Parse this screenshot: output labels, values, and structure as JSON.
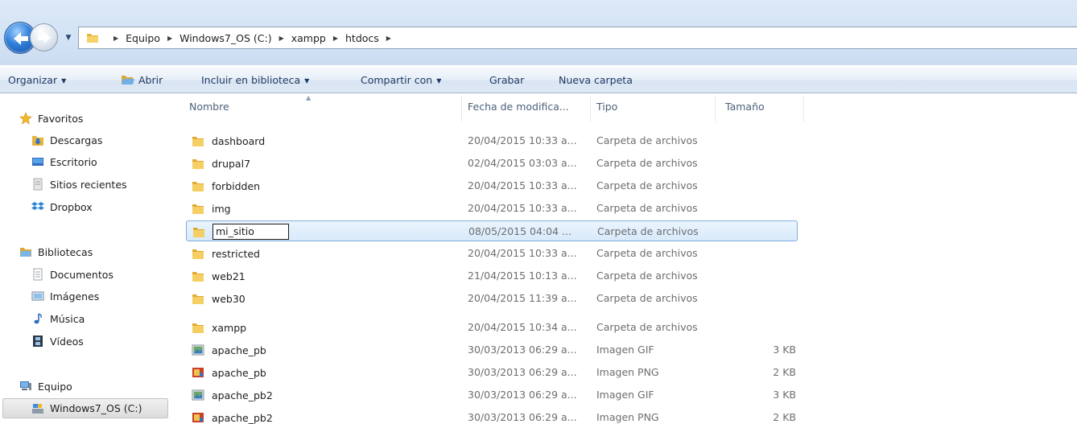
{
  "address_bar": {
    "crumbs": [
      "Equipo",
      "Windows7_OS (C:)",
      "xampp",
      "htdocs"
    ]
  },
  "toolbar": {
    "organize": "Organizar",
    "open": "Abrir",
    "include_library": "Incluir en biblioteca",
    "share_with": "Compartir con",
    "burn": "Grabar",
    "new_folder": "Nueva carpeta"
  },
  "nav": {
    "favorites": "Favoritos",
    "downloads": "Descargas",
    "desktop": "Escritorio",
    "recent": "Sitios recientes",
    "dropbox": "Dropbox",
    "libraries": "Bibliotecas",
    "documents": "Documentos",
    "images": "Imágenes",
    "music": "Música",
    "videos": "Vídeos",
    "computer": "Equipo",
    "drive_c": "Windows7_OS (C:)"
  },
  "columns": {
    "name": "Nombre",
    "date": "Fecha de modifica...",
    "type": "Tipo",
    "size": "Tamaño"
  },
  "files": [
    {
      "name": "dashboard",
      "date": "20/04/2015 10:33 a...",
      "type": "Carpeta de archivos",
      "size": "",
      "icon": "folder-icon"
    },
    {
      "name": "drupal7",
      "date": "02/04/2015 03:03 a...",
      "type": "Carpeta de archivos",
      "size": "",
      "icon": "folder-icon"
    },
    {
      "name": "forbidden",
      "date": "20/04/2015 10:33 a...",
      "type": "Carpeta de archivos",
      "size": "",
      "icon": "folder-icon"
    },
    {
      "name": "img",
      "date": "20/04/2015 10:33 a...",
      "type": "Carpeta de archivos",
      "size": "",
      "icon": "folder-icon"
    },
    {
      "name": "mi_sitio",
      "date": "08/05/2015 04:04 ...",
      "type": "Carpeta de archivos",
      "size": "",
      "icon": "folder-icon"
    },
    {
      "name": "restricted",
      "date": "20/04/2015 10:33 a...",
      "type": "Carpeta de archivos",
      "size": "",
      "icon": "folder-icon"
    },
    {
      "name": "web21",
      "date": "21/04/2015 10:13 a...",
      "type": "Carpeta de archivos",
      "size": "",
      "icon": "folder-icon"
    },
    {
      "name": "web30",
      "date": "20/04/2015 11:39 a...",
      "type": "Carpeta de archivos",
      "size": "",
      "icon": "folder-icon"
    },
    {
      "name": "xampp",
      "date": "20/04/2015 10:34 a...",
      "type": "Carpeta de archivos",
      "size": "",
      "icon": "folder-icon"
    },
    {
      "name": "apache_pb",
      "date": "30/03/2013 06:29 a...",
      "type": "Imagen GIF",
      "size": "3 KB",
      "icon": "gif-file-icon"
    },
    {
      "name": "apache_pb",
      "date": "30/03/2013 06:29 a...",
      "type": "Imagen PNG",
      "size": "2 KB",
      "icon": "png-file-icon"
    },
    {
      "name": "apache_pb2",
      "date": "30/03/2013 06:29 a...",
      "type": "Imagen GIF",
      "size": "3 KB",
      "icon": "gif-file-icon"
    },
    {
      "name": "apache_pb2",
      "date": "30/03/2013 06:29 a...",
      "type": "Imagen PNG",
      "size": "2 KB",
      "icon": "png-file-icon"
    }
  ],
  "renaming_index": 4
}
